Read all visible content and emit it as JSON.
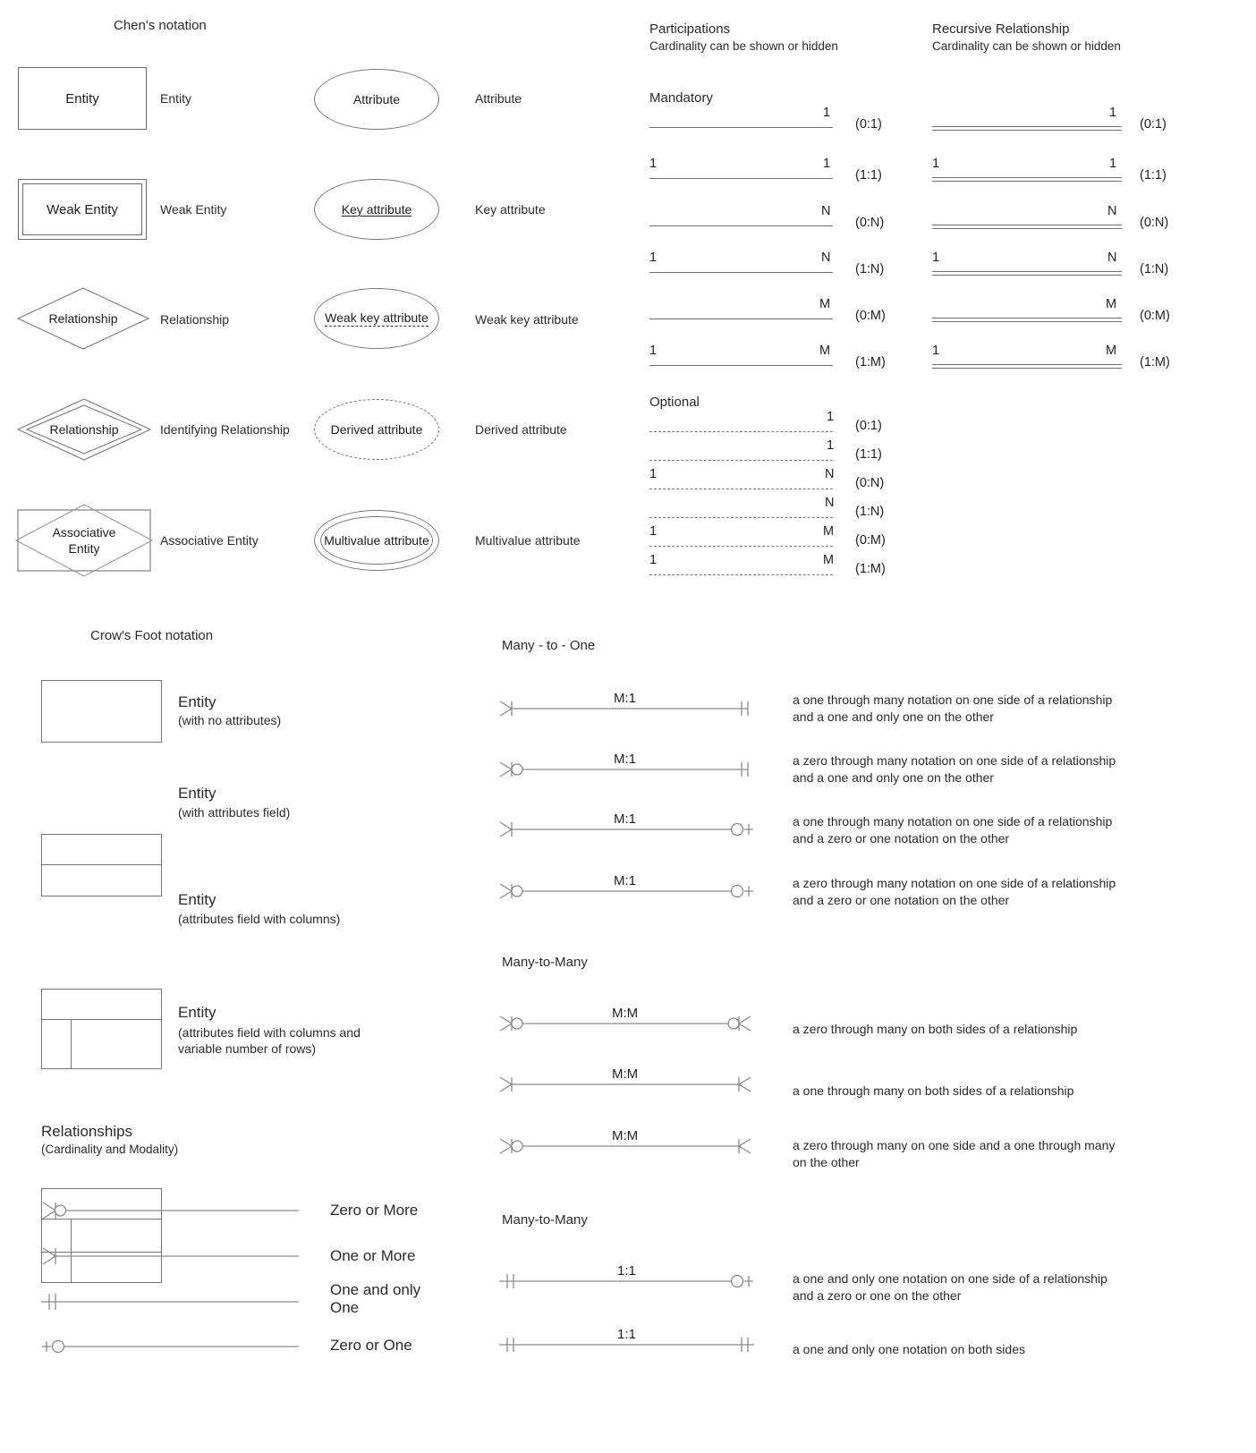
{
  "chen": {
    "title": "Chen's notation",
    "shapes": [
      {
        "id": "entity",
        "shape_text": "Entity",
        "label": "Entity"
      },
      {
        "id": "weak-entity",
        "shape_text": "Weak Entity",
        "label": "Weak Entity"
      },
      {
        "id": "relationship",
        "shape_text": "Relationship",
        "label": "Relationship"
      },
      {
        "id": "identifying-relationship",
        "shape_text": "Relationship",
        "label": "Identifying Relationship"
      },
      {
        "id": "associative-entity",
        "shape_text": "Associative Entity",
        "label": "Associative Entity"
      }
    ],
    "attributes": [
      {
        "id": "attribute",
        "shape_text": "Attribute",
        "label": "Attribute"
      },
      {
        "id": "key-attribute",
        "shape_text": "Key attribute",
        "label": "Key attribute"
      },
      {
        "id": "weak-key-attribute",
        "shape_text": "Weak key attribute",
        "label": "Weak key attribute"
      },
      {
        "id": "derived-attribute",
        "shape_text": "Derived attribute",
        "label": "Derived attribute"
      },
      {
        "id": "multivalue-attribute",
        "shape_text": "Multivalue attribute",
        "label": "Multivalue attribute"
      }
    ]
  },
  "participations": {
    "title": "Participations",
    "subtitle": "Cardinality can be shown or hidden",
    "mandatory_label": "Mandatory",
    "optional_label": "Optional",
    "mandatory_rows": [
      {
        "left": "",
        "right": "1",
        "card": "(0:1)"
      },
      {
        "left": "1",
        "right": "1",
        "card": "(1:1)"
      },
      {
        "left": "",
        "right": "N",
        "card": "(0:N)"
      },
      {
        "left": "1",
        "right": "N",
        "card": "(1:N)"
      },
      {
        "left": "",
        "right": "M",
        "card": "(0:M)"
      },
      {
        "left": "1",
        "right": "M",
        "card": "(1:M)"
      }
    ],
    "optional_rows": [
      {
        "left": "",
        "right": "1",
        "card": "(0:1)"
      },
      {
        "left": "",
        "right": "1",
        "card": "(1:1)"
      },
      {
        "left": "1",
        "right": "N",
        "card": "(0:N)"
      },
      {
        "left": "",
        "right": "N",
        "card": "(1:N)"
      },
      {
        "left": "1",
        "right": "M",
        "card": "(0:M)"
      },
      {
        "left": "1",
        "right": "M",
        "card": "(1:M)"
      }
    ]
  },
  "recursive": {
    "title": "Recursive Relationship",
    "subtitle": "Cardinality can be shown or hidden",
    "rows": [
      {
        "left": "",
        "right": "1",
        "card": "(0:1)"
      },
      {
        "left": "1",
        "right": "1",
        "card": "(1:1)"
      },
      {
        "left": "",
        "right": "N",
        "card": "(0:N)"
      },
      {
        "left": "1",
        "right": "N",
        "card": "(1:N)"
      },
      {
        "left": "",
        "right": "M",
        "card": "(0:M)"
      },
      {
        "left": "1",
        "right": "M",
        "card": "(1:M)"
      }
    ]
  },
  "crowsfoot": {
    "title": "Crow's Foot notation",
    "entities": [
      {
        "name": "Entity",
        "sub": "(with no attributes)"
      },
      {
        "name": "Entity",
        "sub": "(with attributes field)"
      },
      {
        "name": "Entity",
        "sub": "(attributes field with columns)"
      },
      {
        "name": "Entity",
        "sub": "(attributes field with columns and\nvariable number of rows)"
      }
    ],
    "relationships_title": "Relationships",
    "relationships_sub": "(Cardinality and Modality)",
    "symbols": [
      {
        "id": "zero-or-more",
        "label": "Zero or More"
      },
      {
        "id": "one-or-more",
        "label": "One or More"
      },
      {
        "id": "one-and-only-one",
        "label": "One and only\nOne"
      },
      {
        "id": "zero-or-one",
        "label": "Zero or One"
      }
    ]
  },
  "many_to_one": {
    "title": "Many - to - One",
    "rows": [
      {
        "cardinality": "M:1",
        "left_symbol": "one-or-more",
        "right_symbol": "one-and-only-one",
        "description": "a one through many notation on one side of a relationship\nand a one and only one on the other"
      },
      {
        "cardinality": "M:1",
        "left_symbol": "zero-or-more",
        "right_symbol": "one-and-only-one",
        "description": "a zero through many notation on one side of a relationship\nand a one and only one on the other"
      },
      {
        "cardinality": "M:1",
        "left_symbol": "one-or-more",
        "right_symbol": "zero-or-one",
        "description": "a one through many notation on one side of a relationship\nand a zero or one notation on the other"
      },
      {
        "cardinality": "M:1",
        "left_symbol": "zero-or-more",
        "right_symbol": "zero-or-one",
        "description": "a zero through many notation on one side of a relationship\nand a zero or one notation on the other"
      }
    ]
  },
  "many_to_many": {
    "title": "Many-to-Many",
    "rows": [
      {
        "cardinality": "M:M",
        "left_symbol": "zero-or-more",
        "right_symbol": "zero-or-more",
        "description": "a zero through many on both sides of a relationship"
      },
      {
        "cardinality": "M:M",
        "left_symbol": "one-or-more",
        "right_symbol": "one-or-more",
        "description": "a one through many on both sides of a relationship"
      },
      {
        "cardinality": "M:M",
        "left_symbol": "zero-or-more",
        "right_symbol": "one-or-more",
        "description": "a zero through many on one side and a one through many\non the other"
      }
    ]
  },
  "one_to_one": {
    "title": "Many-to-Many",
    "rows": [
      {
        "cardinality": "1:1",
        "left_symbol": "one-and-only-one",
        "right_symbol": "zero-or-one",
        "description": "a one and only one notation on one side of a relationship\nand a zero or one on the other"
      },
      {
        "cardinality": "1:1",
        "left_symbol": "one-and-only-one",
        "right_symbol": "one-and-only-one",
        "description": "a one and only one notation on both sides"
      }
    ]
  },
  "colors": {
    "stroke": "#6f6f6f",
    "text": "#232323",
    "background": "#ffffff"
  }
}
